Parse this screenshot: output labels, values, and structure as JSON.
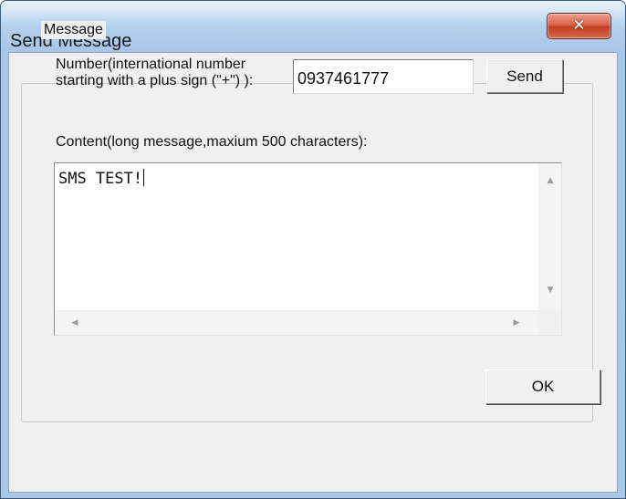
{
  "window": {
    "title": "Send Message",
    "close_icon": "close-icon"
  },
  "message_group": {
    "legend": "Message",
    "number_label": "Number(international number starting with a plus sign (\"+\") ):",
    "number_value": "0937461777",
    "send_label": "Send",
    "content_label": "Content(long message,maxium 500 characters):",
    "content_value": "SMS TEST!"
  },
  "footer": {
    "ok_label": "OK"
  },
  "colors": {
    "title_bar": "#b8d3ef",
    "close_button": "#c13f22",
    "dialog_face": "#f0f0f0"
  }
}
